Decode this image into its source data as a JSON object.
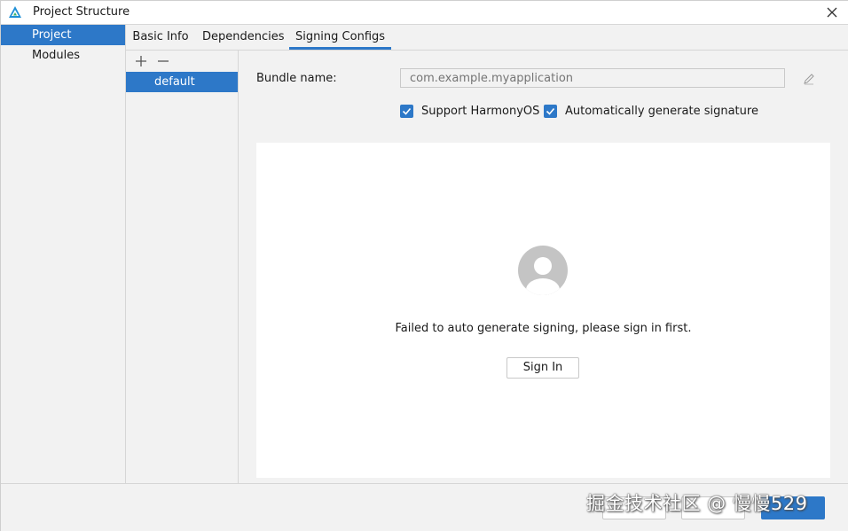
{
  "window": {
    "title": "Project Structure",
    "icons": {
      "app": "deveco-logo-icon",
      "close": "close-icon"
    }
  },
  "sidebar": {
    "items": [
      {
        "label": "Project",
        "selected": true
      },
      {
        "label": "Modules",
        "selected": false
      }
    ]
  },
  "tabs": [
    {
      "label": "Basic Info",
      "active": false
    },
    {
      "label": "Dependencies",
      "active": false
    },
    {
      "label": "Signing Configs",
      "active": true
    }
  ],
  "config_list": {
    "tools": {
      "add": "plus-icon",
      "remove": "minus-icon"
    },
    "items": [
      {
        "label": "default",
        "selected": true
      }
    ]
  },
  "form": {
    "bundle_label": "Bundle name:",
    "bundle_placeholder": "com.example.myapplication",
    "edit_icon": "pencil-icon",
    "support_harmony": {
      "label": "Support HarmonyOS",
      "checked": true
    },
    "auto_signature": {
      "label": "Automatically generate signature",
      "checked": true
    }
  },
  "signin": {
    "avatar_icon": "user-avatar-icon",
    "message": "Failed to auto generate signing, please sign in first.",
    "button_label": "Sign In"
  },
  "watermark": "掘金技术社区 @ 慢慢529",
  "colors": {
    "accent": "#2d78c8",
    "window_bg": "#f2f2f2",
    "panel_bg": "#ffffff",
    "avatar": "#c4c4c4"
  }
}
